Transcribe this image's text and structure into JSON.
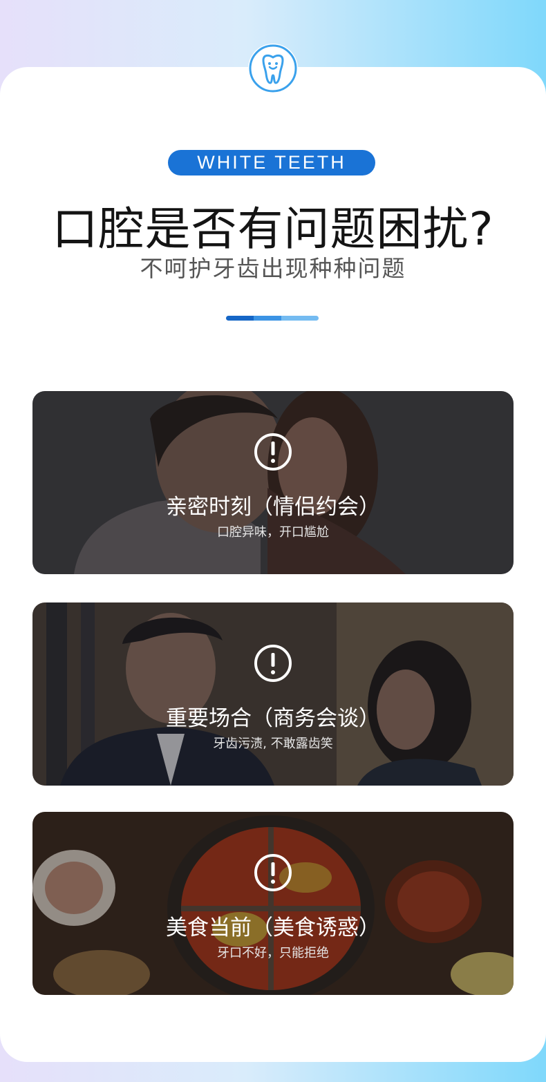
{
  "header": {
    "icon": "tooth-icon",
    "badge_text": "WHITE TEETH",
    "headline": "口腔是否有问题困扰?",
    "subheadline": "不呵护牙齿出现种种问题"
  },
  "colors": {
    "accent": "#1a73d6",
    "text_dark": "#141414",
    "text_gray": "#555555"
  },
  "scenes": [
    {
      "icon": "alert-icon",
      "title": "亲密时刻（情侣约会）",
      "subtitle": "口腔异味，开口尴尬"
    },
    {
      "icon": "alert-icon",
      "title": "重要场合（商务会谈）",
      "subtitle": "牙齿污渍, 不敢露齿笑"
    },
    {
      "icon": "alert-icon",
      "title": "美食当前（美食诱惑）",
      "subtitle": "牙口不好，只能拒绝"
    }
  ]
}
